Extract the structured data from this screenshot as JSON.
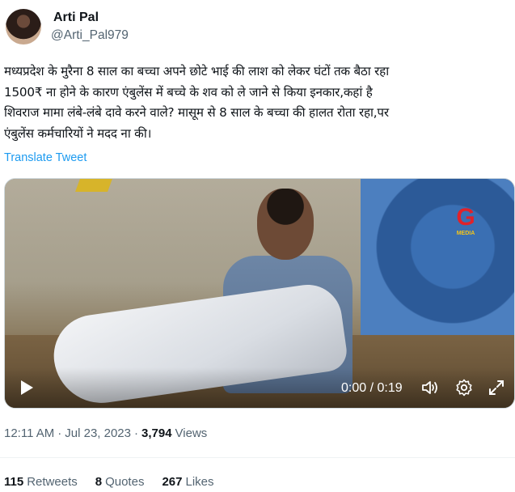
{
  "author": {
    "display_name": "Arti Pal",
    "apple_glyph": "",
    "handle": "@Arti_Pal979"
  },
  "tweet": {
    "text": "मध्यप्रदेश के मुरैना 8 साल का बच्चा अपने छोटे भाई की लाश को लेकर घंटों तक बैठा रहा\n1500₹ ना होने के कारण एंबुलेंस में बच्चे के शव को ले जाने से किया इनकार,कहां है\nशिवराज मामा लंबे-लंबे दावे करने वाले? मासूम से 8 साल के बच्चा की हालत रोता रहा,पर\nएंबुलेंस कर्मचारियों ने मदद ना की।",
    "translate_label": "Translate Tweet"
  },
  "video": {
    "watermark_letter": "G",
    "watermark_sub": "MEDIA",
    "time_display": "0:00 / 0:19",
    "icons": [
      "play-icon",
      "volume-icon",
      "settings-icon",
      "fullscreen-icon"
    ]
  },
  "meta": {
    "time": "12:11 AM",
    "separator": "·",
    "date": "Jul 23, 2023",
    "views_count": "3,794",
    "views_label": "Views"
  },
  "stats": {
    "retweets_count": "115",
    "retweets_label": "Retweets",
    "quotes_count": "8",
    "quotes_label": "Quotes",
    "likes_count": "267",
    "likes_label": "Likes"
  },
  "colors": {
    "link": "#1d9bf0",
    "secondary_text": "#536471",
    "primary_text": "#0f1419",
    "watermark_red": "#e0222a"
  }
}
